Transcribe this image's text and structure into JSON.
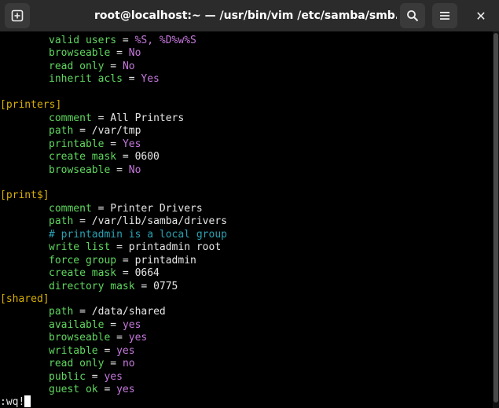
{
  "window": {
    "title": "root@localhost:~ — /usr/bin/vim /etc/samba/smb.conf",
    "icons": {
      "new_tab": "new-tab-icon",
      "search": "search-icon",
      "menu": "hamburger-menu-icon",
      "close": "close-icon"
    },
    "close_glyph": "✕"
  },
  "colors": {
    "key": "#5fd75f",
    "keyword_value": "#c678dd",
    "section": "#d7af00",
    "comment": "#2aa1b3",
    "text": "#e6e6e6",
    "background": "#000000"
  },
  "editor": {
    "lines": [
      {
        "indent": true,
        "key": "valid users",
        "value": "%S, %D%w%S",
        "vtype": "kw"
      },
      {
        "indent": true,
        "key": "browseable",
        "value": "No",
        "vtype": "kw"
      },
      {
        "indent": true,
        "key": "read only",
        "value": "No",
        "vtype": "kw"
      },
      {
        "indent": true,
        "key": "inherit acls",
        "value": "Yes",
        "vtype": "kw"
      },
      {
        "blank": true
      },
      {
        "section": "[printers]"
      },
      {
        "indent": true,
        "key": "comment",
        "value": "All Printers",
        "vtype": "val"
      },
      {
        "indent": true,
        "key": "path",
        "value": "/var/tmp",
        "vtype": "val"
      },
      {
        "indent": true,
        "key": "printable",
        "value": "Yes",
        "vtype": "kw"
      },
      {
        "indent": true,
        "key": "create mask",
        "value": "0600",
        "vtype": "val"
      },
      {
        "indent": true,
        "key": "browseable",
        "value": "No",
        "vtype": "kw"
      },
      {
        "blank": true
      },
      {
        "section": "[print$]"
      },
      {
        "indent": true,
        "key": "comment",
        "value": "Printer Drivers",
        "vtype": "val"
      },
      {
        "indent": true,
        "key": "path",
        "value": "/var/lib/samba/drivers",
        "vtype": "val"
      },
      {
        "indent": true,
        "comment": "# printadmin is a local group"
      },
      {
        "indent": true,
        "key": "write list",
        "value": "printadmin root",
        "vtype": "val"
      },
      {
        "indent": true,
        "key": "force group",
        "value": "printadmin",
        "vtype": "val"
      },
      {
        "indent": true,
        "key": "create mask",
        "value": "0664",
        "vtype": "val"
      },
      {
        "indent": true,
        "key": "directory mask",
        "value": "0775",
        "vtype": "val"
      },
      {
        "section": "[shared]"
      },
      {
        "indent": true,
        "key": "path",
        "value": "/data/shared",
        "vtype": "val"
      },
      {
        "indent": true,
        "key": "available",
        "value": "yes",
        "vtype": "kw"
      },
      {
        "indent": true,
        "key": "browseable",
        "value": "yes",
        "vtype": "kw"
      },
      {
        "indent": true,
        "key": "writable",
        "value": "yes",
        "vtype": "kw"
      },
      {
        "indent": true,
        "key": "read only",
        "value": "no",
        "vtype": "kw"
      },
      {
        "indent": true,
        "key": "public",
        "value": "yes",
        "vtype": "kw"
      },
      {
        "indent": true,
        "key": "guest ok",
        "value": "yes",
        "vtype": "kw"
      }
    ],
    "command_line": ":wq!"
  }
}
